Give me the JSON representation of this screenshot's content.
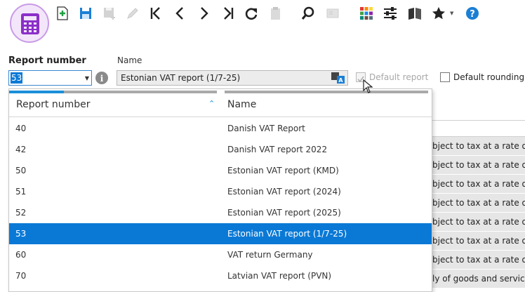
{
  "toolbar": {
    "icons": [
      "calculator-logo",
      "new-icon",
      "save-icon",
      "save-disabled-icon",
      "edit-disabled-icon",
      "first-icon",
      "previous-icon",
      "next-icon",
      "last-icon",
      "refresh-icon",
      "clipboard-disabled-icon",
      "search-icon",
      "card-disabled-icon",
      "color-grid-icon",
      "settings-sliders-icon",
      "book-icon",
      "star-icon",
      "help-icon"
    ],
    "colors": {
      "new": "#1e9e3e",
      "save": "#1b7fd4",
      "help": "#1b7fd4",
      "logo_bg": "#f3e6fb",
      "logo_ring": "#c99be6",
      "logo_calc": "#8b2fc9"
    }
  },
  "form": {
    "report_number_label": "Report number",
    "report_number_value": "53",
    "name_label": "Name",
    "name_value": "Estonian VAT report (1/7-25)",
    "default_report_label": "Default report",
    "default_report_checked": true,
    "default_report_enabled": false,
    "default_rounding_label": "Default rounding",
    "default_rounding_checked": false
  },
  "dropdown": {
    "columns": [
      "Report number",
      "Name"
    ],
    "sort_column": "Report number",
    "sort_indicator": "⌃",
    "selected_index": 5,
    "rows": [
      {
        "number": "40",
        "name": "Danish VAT Report"
      },
      {
        "number": "42",
        "name": "Danish VAT report 2022"
      },
      {
        "number": "50",
        "name": "Estonian VAT report (KMD)"
      },
      {
        "number": "51",
        "name": "Estonian VAT report (2024)"
      },
      {
        "number": "52",
        "name": "Estonian VAT report (2025)"
      },
      {
        "number": "53",
        "name": "Estonian VAT report (1/7-25)"
      },
      {
        "number": "60",
        "name": "VAT return Germany"
      },
      {
        "number": "70",
        "name": "Latvian VAT report (PVN)"
      }
    ],
    "selected_color": "#0a79d6"
  },
  "background_grid": {
    "rows": [
      "bject to tax at a rate o",
      "bject to tax at a rate o",
      "bject to tax at a rate o",
      "bject to tax at a rate o",
      "bject to tax at a rate o",
      "bject to tax at a rate o",
      "bject to tax at a rate o",
      "ly of goods and service"
    ]
  }
}
